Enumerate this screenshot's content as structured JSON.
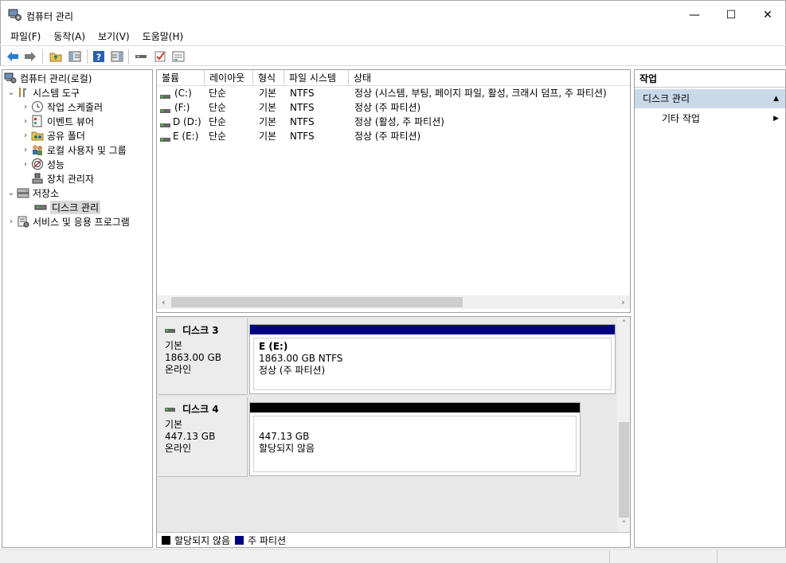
{
  "window": {
    "title": "컴퓨터 관리",
    "minimize_glyph": "—",
    "maximize_glyph": "☐",
    "close_glyph": "✕"
  },
  "menu": [
    "파일(F)",
    "동작(A)",
    "보기(V)",
    "도움말(H)"
  ],
  "toolbar": {
    "icons": [
      "back-arrow-icon",
      "forward-arrow-icon",
      "up-folder-icon",
      "show-hide-tree-icon",
      "help-icon",
      "show-hide-action-pane-icon",
      "connect-icon",
      "checkmark-icon",
      "properties-icon"
    ]
  },
  "tree": {
    "root": "컴퓨터 관리(로컬)",
    "system_tools": "시스템 도구",
    "task_scheduler": "작업 스케줄러",
    "event_viewer": "이벤트 뷰어",
    "shared_folders": "공유 폴더",
    "local_users": "로컬 사용자 및 그룹",
    "performance": "성능",
    "device_manager": "장치 관리자",
    "storage": "저장소",
    "disk_management": "디스크 관리",
    "services_apps": "서비스 및 응용 프로그램"
  },
  "volumes": {
    "headers": [
      "볼륨",
      "레이아웃",
      "형식",
      "파일 시스템",
      "상태"
    ],
    "rows": [
      {
        "volume": "(C:)",
        "layout": "단순",
        "type": "기본",
        "fs": "NTFS",
        "status": "정상 (시스템, 부팅, 페이지 파일, 활성, 크래시 덤프, 주 파티션)"
      },
      {
        "volume": "(F:)",
        "layout": "단순",
        "type": "기본",
        "fs": "NTFS",
        "status": "정상 (주 파티션)"
      },
      {
        "volume": "D (D:)",
        "layout": "단순",
        "type": "기본",
        "fs": "NTFS",
        "status": "정상 (활성, 주 파티션)"
      },
      {
        "volume": "E (E:)",
        "layout": "단순",
        "type": "기본",
        "fs": "NTFS",
        "status": "정상 (주 파티션)"
      }
    ]
  },
  "disks": [
    {
      "name": "디스크 3",
      "type": "기본",
      "size": "1863.00 GB",
      "state": "온라인",
      "partition": {
        "title": "E  (E:)",
        "line1": "1863.00 GB NTFS",
        "line2": "정상 (주 파티션)"
      },
      "bar_color": "#000080"
    },
    {
      "name": "디스크 4",
      "type": "기본",
      "size": "447.13 GB",
      "state": "온라인",
      "partition": {
        "title": "",
        "line1": "447.13 GB",
        "line2": "할당되지 않음"
      },
      "bar_color": "#000000"
    }
  ],
  "legend": [
    {
      "label": "할당되지 않음",
      "color": "#000000"
    },
    {
      "label": "주 파티션",
      "color": "#000080"
    }
  ],
  "actions": {
    "title": "작업",
    "section": "디스크 관리",
    "more": "기타 작업"
  },
  "colors": {
    "selection": "#d9d9d9",
    "action_section_bg": "#c9d9ea",
    "primary_partition": "#000080",
    "unallocated": "#000000"
  }
}
